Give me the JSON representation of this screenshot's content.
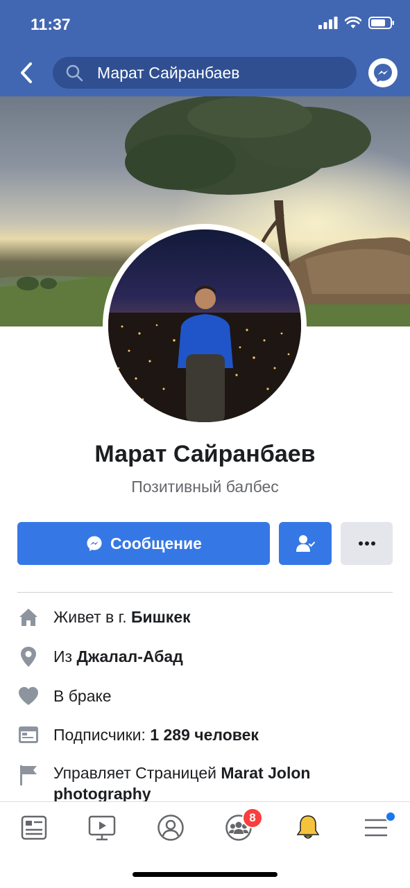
{
  "status": {
    "time": "11:37"
  },
  "header": {
    "search_text": "Марат Сайранбаев",
    "back_icon": "chevron-left-icon",
    "search_icon": "search-icon",
    "messenger_icon": "messenger-icon"
  },
  "profile": {
    "name": "Марат Сайранбаев",
    "bio": "Позитивный балбес"
  },
  "actions": {
    "message_label": "Сообщение",
    "friend_icon": "friend-check-icon",
    "more_icon": "more-dots-icon"
  },
  "info": [
    {
      "icon": "home-icon",
      "prefix": "Живет в г. ",
      "bold": "Бишкек"
    },
    {
      "icon": "location-pin-icon",
      "prefix": "Из ",
      "bold": "Джалал-Абад"
    },
    {
      "icon": "heart-icon",
      "prefix": "В браке",
      "bold": ""
    },
    {
      "icon": "followers-icon",
      "prefix": "Подписчики: ",
      "bold": "1 289 человек"
    },
    {
      "icon": "flag-icon",
      "prefix": "Управляет Страницей ",
      "bold": "Marat Jolon photography"
    }
  ],
  "tabbar": {
    "tabs": [
      "news-feed-icon",
      "watch-icon",
      "profile-icon",
      "groups-icon",
      "notifications-icon",
      "menu-icon"
    ],
    "groups_badge": "8"
  },
  "colors": {
    "brand": "#4267b2",
    "accent": "#3578e5",
    "badge": "#fa3e3e"
  }
}
